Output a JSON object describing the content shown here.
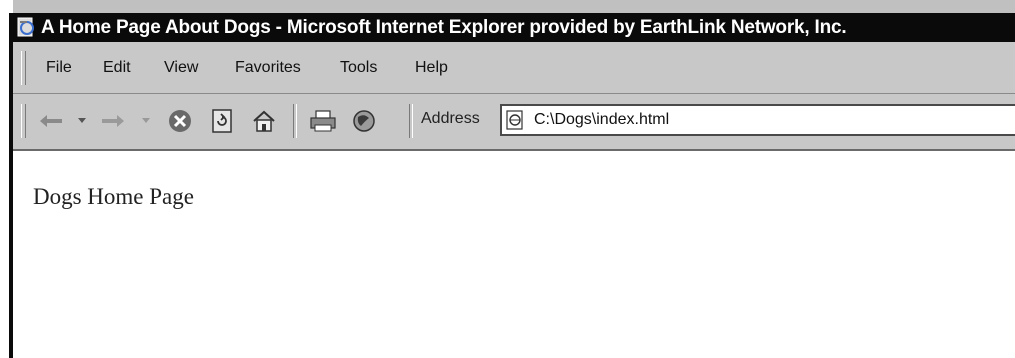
{
  "window": {
    "title": "A Home Page About Dogs - Microsoft Internet Explorer provided by EarthLink Network, Inc.",
    "title_icon": "ie-page-icon"
  },
  "menubar": {
    "items": [
      {
        "label": "File"
      },
      {
        "label": "Edit"
      },
      {
        "label": "View"
      },
      {
        "label": "Favorites"
      },
      {
        "label": "Tools"
      },
      {
        "label": "Help"
      }
    ]
  },
  "toolbar": {
    "buttons": [
      {
        "name": "back",
        "icon": "back-arrow-icon"
      },
      {
        "name": "back-dropdown",
        "icon": "dropdown-arrow-icon"
      },
      {
        "name": "forward",
        "icon": "forward-arrow-icon"
      },
      {
        "name": "forward-dropdown",
        "icon": "dropdown-arrow-icon"
      },
      {
        "name": "stop",
        "icon": "stop-icon"
      },
      {
        "name": "refresh",
        "icon": "refresh-icon"
      },
      {
        "name": "home",
        "icon": "home-icon"
      },
      {
        "name": "print",
        "icon": "print-icon"
      },
      {
        "name": "media",
        "icon": "globe-icon"
      }
    ],
    "address_label": "Address",
    "address_value": "C:\\Dogs\\index.html",
    "address_icon": "html-file-icon"
  },
  "page": {
    "heading": "Dogs Home Page"
  }
}
